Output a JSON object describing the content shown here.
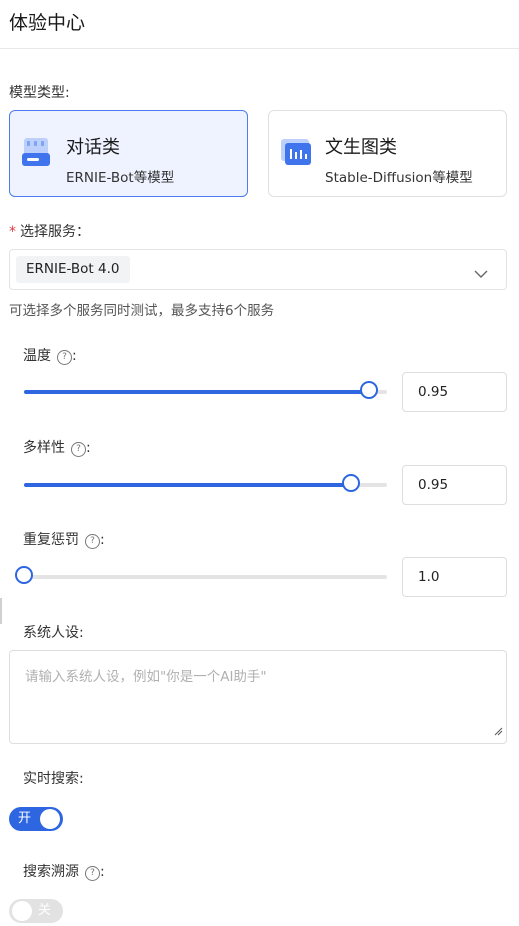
{
  "page": {
    "title": "体验中心"
  },
  "model_type": {
    "label": "模型类型:",
    "cards": [
      {
        "title": "对话类",
        "subtitle": "ERNIE-Bot等模型",
        "icon": "chat-model-icon",
        "selected": true
      },
      {
        "title": "文生图类",
        "subtitle": "Stable-Diffusion等模型",
        "icon": "image-model-icon",
        "selected": false
      }
    ]
  },
  "service": {
    "required_mark": "*",
    "label": "选择服务：",
    "selected_tag": "ERNIE-Bot 4.0",
    "hint": "可选择多个服务同时测试，最多支持6个服务"
  },
  "params": {
    "help_glyph": "?",
    "temperature": {
      "label": "温度",
      "colon": ":",
      "value": "0.95",
      "level": 0.95
    },
    "top_p": {
      "label": "多样性",
      "colon": ":",
      "value": "0.95",
      "level": 0.9
    },
    "penalty": {
      "label": "重复惩罚",
      "colon": ":",
      "value": "1.0",
      "level": 0.0
    }
  },
  "system_prompt": {
    "label": "系统人设:",
    "placeholder": "请输入系统人设，例如\"你是一个AI助手\""
  },
  "realtime_search": {
    "label": "实时搜索:",
    "state_label": "开",
    "on": true
  },
  "search_source": {
    "label": "搜索溯源",
    "colon": ":",
    "state_label": "关",
    "on": false
  },
  "colors": {
    "accent": "#2d66e0",
    "card_active_bg": "#eef3ff",
    "required": "#e0393e"
  }
}
